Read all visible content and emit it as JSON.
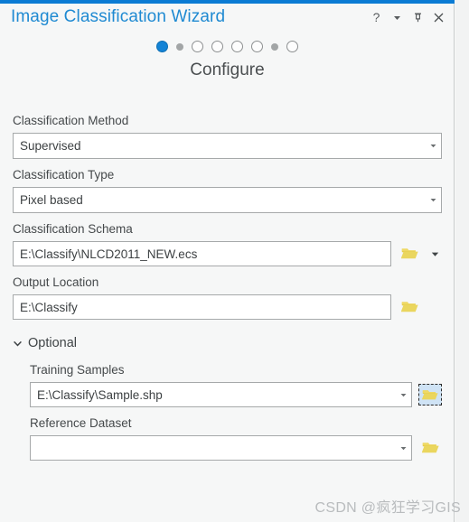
{
  "window": {
    "title": "Image Classification Wizard",
    "accent_color": "#0a7bd4",
    "title_color": "#1f8ad2",
    "controls": [
      {
        "name": "help-icon",
        "glyph": "?"
      },
      {
        "name": "menu-chevron-down-icon",
        "glyph": "▾"
      },
      {
        "name": "pin-icon",
        "glyph": "⚐"
      },
      {
        "name": "close-icon",
        "glyph": "✕"
      }
    ]
  },
  "steps": {
    "current_index": 0,
    "total": 8,
    "dots": [
      "big-filled",
      "small",
      "big-empty",
      "big-empty",
      "big-empty",
      "big-empty",
      "small",
      "big-empty"
    ],
    "active_color": "#1383d6",
    "inactive_color": "#a2a5a6"
  },
  "page": {
    "heading": "Configure"
  },
  "form": {
    "classification_method": {
      "label": "Classification Method",
      "value": "Supervised",
      "placeholder": ""
    },
    "classification_type": {
      "label": "Classification Type",
      "value": "Pixel based",
      "placeholder": ""
    },
    "classification_schema": {
      "label": "Classification Schema",
      "value": "E:\\Classify\\NLCD2011_NEW.ecs",
      "placeholder": "",
      "browse_icon": "folder-open-icon",
      "has_split_caret": true
    },
    "output_location": {
      "label": "Output Location",
      "value": "E:\\Classify",
      "placeholder": "",
      "browse_icon": "folder-open-icon"
    }
  },
  "optional": {
    "label": "Optional",
    "expanded": true,
    "training_samples": {
      "label": "Training Samples",
      "value": "E:\\Classify\\Sample.shp",
      "placeholder": "",
      "browse_icon": "folder-open-icon",
      "browse_focused": true
    },
    "reference_dataset": {
      "label": "Reference Dataset",
      "value": "",
      "placeholder": "",
      "browse_icon": "folder-open-icon"
    }
  },
  "watermark": {
    "text": "CSDN @疯狂学习GIS"
  }
}
